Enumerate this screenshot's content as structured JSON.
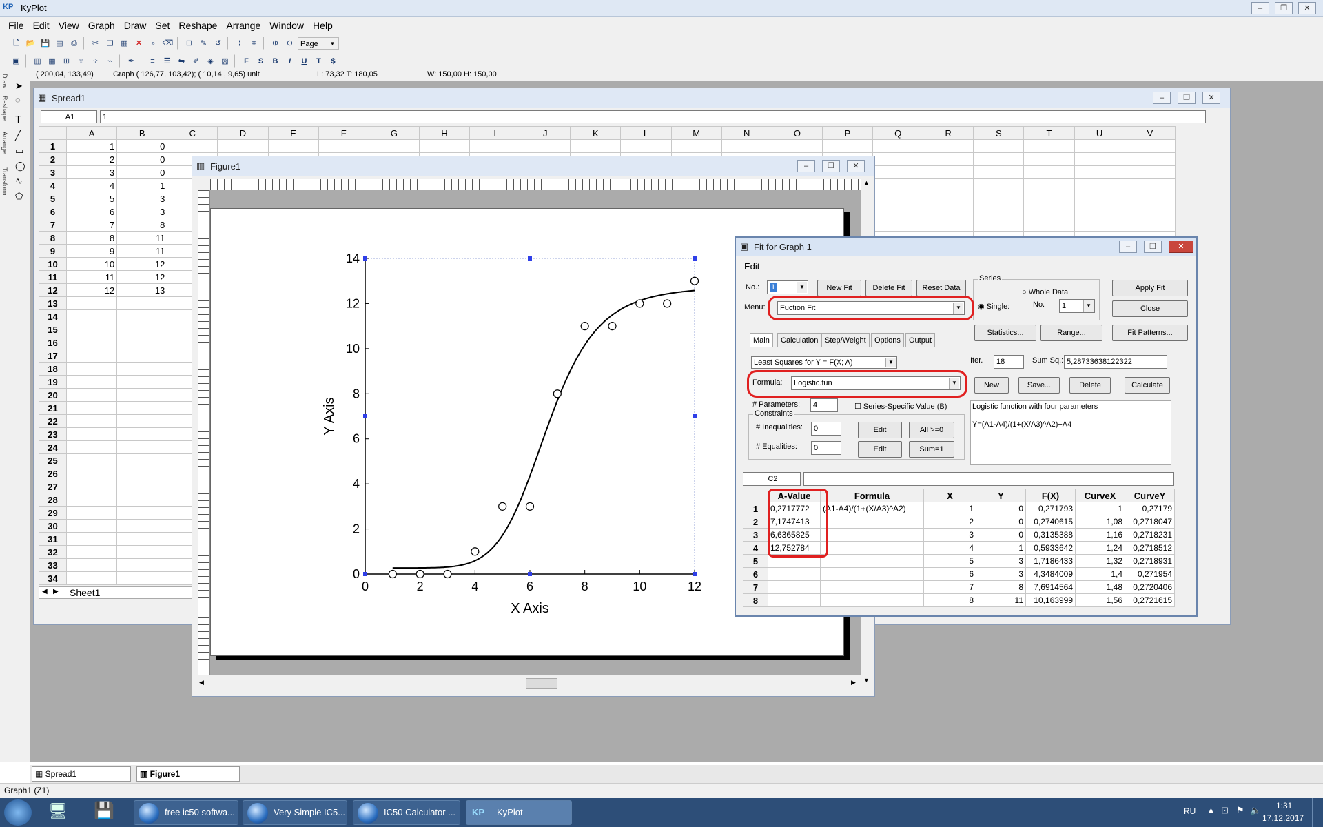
{
  "app": {
    "title": "KyPlot",
    "logo": "KP"
  },
  "menu": [
    "File",
    "Edit",
    "View",
    "Graph",
    "Draw",
    "Set",
    "Reshape",
    "Arrange",
    "Window",
    "Help"
  ],
  "toolbar1": {
    "zoom_value": "Page"
  },
  "status": {
    "cursor": "( 200,04, 133,49)",
    "graph": "Graph ( 126,77, 103,42); ( 10,14 , 9,65) unit",
    "pos": "L: 73,32  T: 180,05",
    "size": "W: 150,00  H: 150,00"
  },
  "left_tabs": [
    "Draw",
    "Reshape",
    "Arrange",
    "Transform"
  ],
  "spread": {
    "title": "Spread1",
    "cell_ref": "A1",
    "cell_value": "1",
    "columns": [
      "A",
      "B",
      "C",
      "D",
      "E",
      "F",
      "G",
      "H",
      "I",
      "J",
      "K",
      "L",
      "M",
      "N",
      "O",
      "P",
      "Q",
      "R",
      "S",
      "T",
      "U",
      "V"
    ],
    "rows": [
      "1",
      "2",
      "3",
      "4",
      "5",
      "6",
      "7",
      "8",
      "9",
      "10",
      "11",
      "12",
      "13",
      "14",
      "15",
      "16",
      "17",
      "18",
      "19",
      "20",
      "21",
      "22",
      "23",
      "24",
      "25",
      "26",
      "27",
      "28",
      "29",
      "30",
      "31",
      "32",
      "33",
      "34"
    ],
    "colA": [
      "1",
      "2",
      "3",
      "4",
      "5",
      "6",
      "7",
      "8",
      "9",
      "10",
      "11",
      "12"
    ],
    "colB": [
      "0",
      "0",
      "0",
      "1",
      "3",
      "3",
      "8",
      "11",
      "11",
      "12",
      "12",
      "13"
    ],
    "sheet_tab": "Sheet1"
  },
  "figure": {
    "title": "Figure1",
    "chart_data": {
      "type": "scatter",
      "xlabel": "X Axis",
      "ylabel": "Y Axis",
      "xlim": [
        0,
        12
      ],
      "ylim": [
        0,
        14
      ],
      "xticks": [
        0,
        2,
        4,
        6,
        8,
        10,
        12
      ],
      "yticks": [
        0,
        2,
        4,
        6,
        8,
        10,
        12,
        14
      ],
      "x": [
        1,
        2,
        3,
        4,
        5,
        6,
        7,
        8,
        9,
        10,
        11,
        12
      ],
      "y": [
        0,
        0,
        0,
        1,
        3,
        3,
        8,
        11,
        11,
        12,
        12,
        13
      ],
      "fit_curve": {
        "formula": "Y=(A1-A4)/(1+(X/A3)^A2)+A4",
        "A1": 0.2717772,
        "A2": 7.1747413,
        "A3": 6.6365825,
        "A4": 12.752784,
        "x_from": 1,
        "x_to": 12
      }
    }
  },
  "fit": {
    "title": "Fit for Graph 1",
    "menu_edit": "Edit",
    "no_label": "No.:",
    "no_value": "1",
    "new_fit": "New Fit",
    "delete_fit": "Delete Fit",
    "reset_data": "Reset Data",
    "series_label": "Series",
    "whole_data": "Whole Data",
    "single": "Single:",
    "no2_label": "No.",
    "no2_value": "1",
    "apply_fit": "Apply Fit",
    "close": "Close",
    "menu_label": "Menu:",
    "menu_value": "Fuction Fit",
    "statistics": "Statistics...",
    "range": "Range...",
    "fit_patterns": "Fit Patterns...",
    "tabs": [
      "Main",
      "Calculation",
      "Step/Weight",
      "Options",
      "Output"
    ],
    "method": "Least Squares for Y = F(X; A)",
    "iter_label": "Iter.",
    "iter_value": "18",
    "sumsq_label": "Sum Sq.:",
    "sumsq_value": "5,28733638122322",
    "formula_label": "Formula:",
    "formula_value": "Logistic.fun",
    "new": "New",
    "save": "Save...",
    "delete": "Delete",
    "calculate": "Calculate",
    "params_label": "# Parameters:",
    "params_value": "4",
    "series_specific": "Series-Specific Value (B)",
    "constraints": "Constraints",
    "ineq_label": "# Inequalities:",
    "ineq_value": "0",
    "eq_label": "# Equalities:",
    "eq_value": "0",
    "edit": "Edit",
    "all_ge0": "All >=0",
    "sum1": "Sum=1",
    "desc1": "Logistic function with four parameters",
    "desc2": "Y=(A1-A4)/(1+(X/A3)^A2)+A4",
    "cell_ref": "C2",
    "table_headers": [
      "A-Value",
      "Formula",
      "X",
      "Y",
      "F(X)",
      "CurveX",
      "CurveY"
    ],
    "table_rows": [
      [
        "1",
        "0,2717772",
        "(A1-A4)/(1+(X/A3)^A2)",
        "1",
        "0",
        "0,271793",
        "1",
        "0,27179"
      ],
      [
        "2",
        "7,1747413",
        "",
        "2",
        "0",
        "0,2740615",
        "1,08",
        "0,2718047"
      ],
      [
        "3",
        "6,6365825",
        "",
        "3",
        "0",
        "0,3135388",
        "1,16",
        "0,2718231"
      ],
      [
        "4",
        "12,752784",
        "",
        "4",
        "1",
        "0,5933642",
        "1,24",
        "0,2718512"
      ],
      [
        "5",
        "",
        "",
        "5",
        "3",
        "1,7186433",
        "1,32",
        "0,2718931"
      ],
      [
        "6",
        "",
        "",
        "6",
        "3",
        "4,3484009",
        "1,4",
        "0,271954"
      ],
      [
        "7",
        "",
        "",
        "7",
        "8",
        "7,6914564",
        "1,48",
        "0,2720406"
      ],
      [
        "8",
        "",
        "",
        "8",
        "11",
        "10,163999",
        "1,56",
        "0,2721615"
      ]
    ]
  },
  "bottom_tabs": [
    "Spread1",
    "Figure1"
  ],
  "statusbar": "Graph1 (Z1)",
  "taskbar": {
    "items": [
      "free ic50 softwa...",
      "Very Simple IC5...",
      "IC50 Calculator ...",
      "KyPlot"
    ],
    "lang": "RU",
    "time": "1:31",
    "date": "17.12.2017"
  }
}
